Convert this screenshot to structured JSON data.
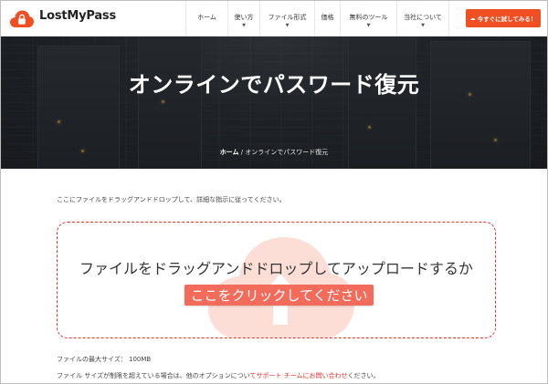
{
  "brand": {
    "name": "LostMyPass",
    "color": "#f04e23"
  },
  "nav": {
    "items": [
      {
        "label": "ホーム",
        "dropdown": false
      },
      {
        "label": "使い方",
        "dropdown": true
      },
      {
        "label": "ファイル形式",
        "dropdown": true
      },
      {
        "label": "価格",
        "dropdown": false
      },
      {
        "label": "無料のツール",
        "dropdown": true
      },
      {
        "label": "当社について",
        "dropdown": true
      }
    ],
    "cta_label": "今すぐに試してみる！"
  },
  "hero": {
    "title": "オンラインでパスワード復元",
    "breadcrumb": {
      "home": "ホーム",
      "separator": " / ",
      "current": "オンラインでパスワード復元"
    }
  },
  "main": {
    "instruction": "ここにファイルをドラッグアンドドロップして、詳細な指示に従ってください。",
    "dropzone": {
      "text": "ファイルをドラッグアンドドロップしてアップロードするか",
      "button_label": "ここをクリックしてください",
      "border_color": "#e8332d",
      "button_color": "#f26b5b"
    },
    "max_size": "ファイルの最大サイズ： 100MB",
    "big_file": {
      "prefix": "ファイル サイズが制限を超えている場合は、他のオプションについ",
      "link": "てサポート チームにお問い合わせ",
      "suffix": "ください。"
    }
  }
}
